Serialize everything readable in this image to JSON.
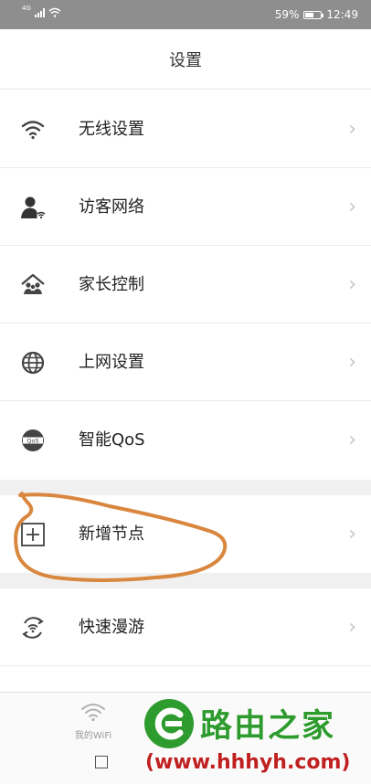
{
  "status_bar": {
    "network": "4G",
    "battery_percent": "59%",
    "battery_level": 0.59,
    "time": "12:49"
  },
  "header": {
    "title": "设置"
  },
  "menu_group_1": [
    {
      "label": "无线设置",
      "icon": "wifi-icon"
    },
    {
      "label": "访客网络",
      "icon": "guest-user-icon"
    },
    {
      "label": "家长控制",
      "icon": "parental-control-icon"
    },
    {
      "label": "上网设置",
      "icon": "globe-icon"
    },
    {
      "label": "智能QoS",
      "icon": "qos-icon",
      "icon_text": "QoS"
    }
  ],
  "menu_group_2": [
    {
      "label": "新增节点",
      "icon": "add-node-icon"
    }
  ],
  "menu_group_3": [
    {
      "label": "快速漫游",
      "icon": "fast-roaming-icon"
    }
  ],
  "chevron": "›",
  "bottom_tabs": [
    {
      "label": "我的WiFi",
      "icon": "wifi-icon"
    }
  ],
  "watermark": {
    "title": "路由之家",
    "url": "(www.hhhyh.com)"
  },
  "colors": {
    "annotation_stroke": "#d9873e",
    "watermark_green": "#2e9b2e",
    "watermark_red": "#c02020"
  }
}
